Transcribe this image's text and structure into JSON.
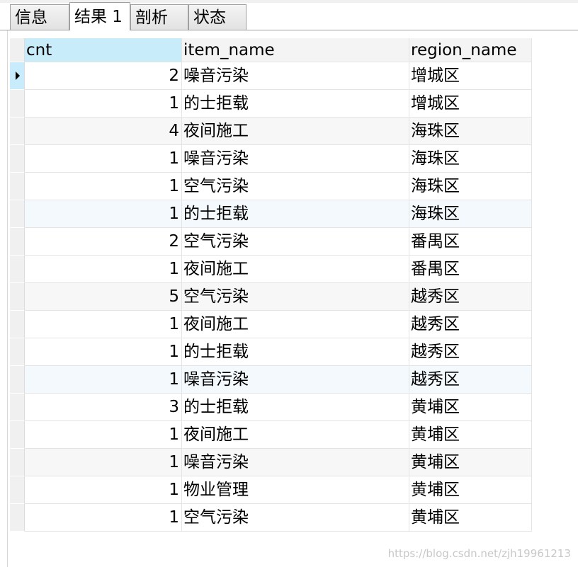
{
  "tabs": [
    {
      "label": "信息"
    },
    {
      "label": "结果 1"
    },
    {
      "label": "剖析"
    },
    {
      "label": "状态"
    }
  ],
  "grid": {
    "columns": [
      "cnt",
      "item_name",
      "region_name"
    ],
    "rows": [
      {
        "cnt": "2",
        "item_name": "噪音污染",
        "region_name": "增城区"
      },
      {
        "cnt": "1",
        "item_name": "的士拒载",
        "region_name": "增城区"
      },
      {
        "cnt": "4",
        "item_name": "夜间施工",
        "region_name": "海珠区"
      },
      {
        "cnt": "1",
        "item_name": "噪音污染",
        "region_name": "海珠区"
      },
      {
        "cnt": "1",
        "item_name": "空气污染",
        "region_name": "海珠区"
      },
      {
        "cnt": "1",
        "item_name": "的士拒载",
        "region_name": "海珠区"
      },
      {
        "cnt": "2",
        "item_name": "空气污染",
        "region_name": "番禺区"
      },
      {
        "cnt": "1",
        "item_name": "夜间施工",
        "region_name": "番禺区"
      },
      {
        "cnt": "5",
        "item_name": "空气污染",
        "region_name": "越秀区"
      },
      {
        "cnt": "1",
        "item_name": "夜间施工",
        "region_name": "越秀区"
      },
      {
        "cnt": "1",
        "item_name": "的士拒载",
        "region_name": "越秀区"
      },
      {
        "cnt": "1",
        "item_name": "噪音污染",
        "region_name": "越秀区"
      },
      {
        "cnt": "3",
        "item_name": "的士拒载",
        "region_name": "黄埔区"
      },
      {
        "cnt": "1",
        "item_name": "夜间施工",
        "region_name": "黄埔区"
      },
      {
        "cnt": "1",
        "item_name": "噪音污染",
        "region_name": "黄埔区"
      },
      {
        "cnt": "1",
        "item_name": "物业管理",
        "region_name": "黄埔区"
      },
      {
        "cnt": "1",
        "item_name": "空气污染",
        "region_name": "黄埔区"
      }
    ]
  },
  "watermark": "https://blog.csdn.net/zjh19961213",
  "colors": {
    "selected_header": "#c9ecfb",
    "row_indicator_current": "#c8ecfb"
  }
}
